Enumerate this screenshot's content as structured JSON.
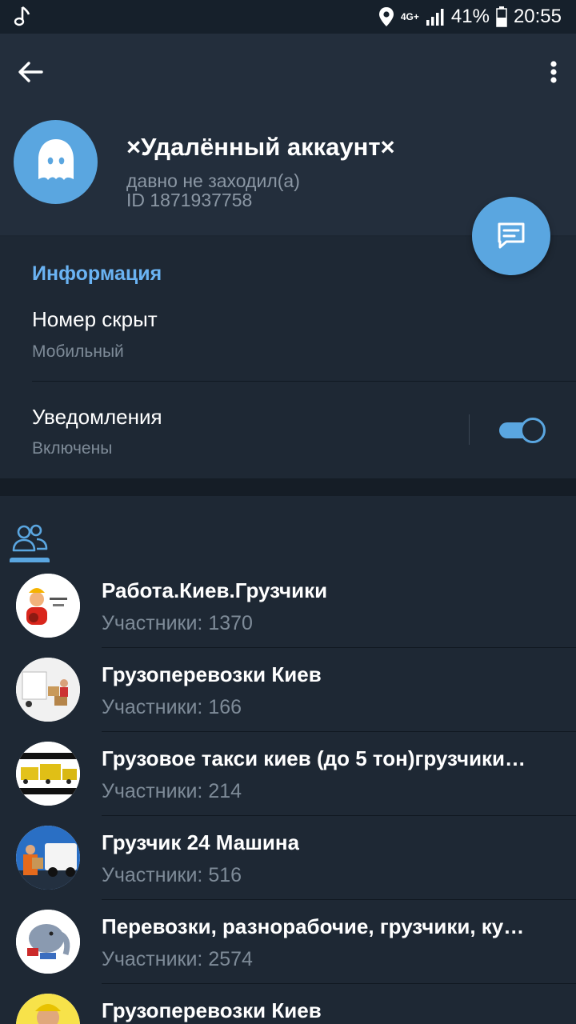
{
  "status_bar": {
    "network": "4G+",
    "battery": "41%",
    "time": "20:55"
  },
  "profile": {
    "name": "×Удалённый аккаунт×",
    "last_seen": "давно не заходил(а)",
    "id_text": "ID 1871937758"
  },
  "info": {
    "heading": "Информация",
    "phone_title": "Номер скрыт",
    "phone_sub": "Мобильный",
    "notifications_title": "Уведомления",
    "notifications_sub": "Включены",
    "notifications_on": true
  },
  "groups": [
    {
      "title": "Работа.Киев.Грузчики",
      "members": "Участники: 1370"
    },
    {
      "title": "Грузоперевозки Киев",
      "members": "Участники: 166"
    },
    {
      "title": "Грузовое такси киев (до 5 тон)грузчики…",
      "members": "Участники: 214"
    },
    {
      "title": "Грузчик 24 Машина",
      "members": "Участники: 516"
    },
    {
      "title": "Перевозки, разнорабочие, грузчики, ку…",
      "members": "Участники: 2574"
    },
    {
      "title": "Грузоперевозки Киев",
      "members": ""
    }
  ],
  "icons": {
    "status_music": "music-note-icon",
    "status_location": "location-icon",
    "status_signal": "signal-icon",
    "status_battery": "battery-icon",
    "back": "back-arrow-icon",
    "more": "more-vertical-icon",
    "avatar": "ghost-icon",
    "fab": "message-icon",
    "groups_tab": "people-icon"
  },
  "colors": {
    "accent": "#5aa6e0",
    "heading_blue": "#6ab3f3",
    "background": "#1d2733",
    "header_bg": "#232e3c"
  }
}
